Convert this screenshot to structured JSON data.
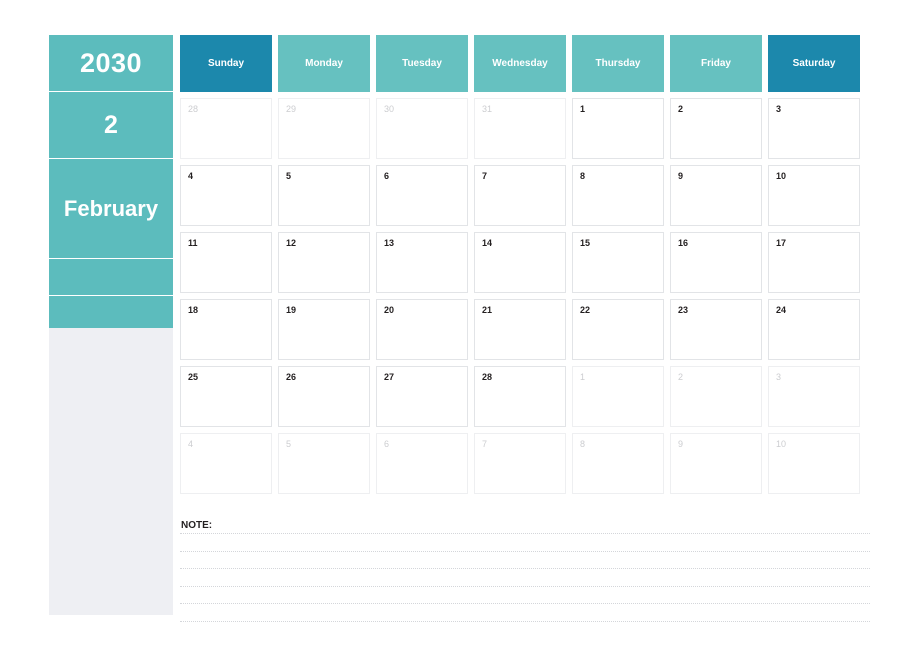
{
  "calendar": {
    "sidebar": {
      "year": "2030",
      "month_number": "2",
      "month_name": "February",
      "blank_block_1": "",
      "blank_block_2": ""
    },
    "weekday_headers": [
      {
        "label": "Sunday",
        "weekend": true
      },
      {
        "label": "Monday",
        "weekend": false
      },
      {
        "label": "Tuesday",
        "weekend": false
      },
      {
        "label": "Wednesday",
        "weekend": false
      },
      {
        "label": "Thursday",
        "weekend": false
      },
      {
        "label": "Friday",
        "weekend": false
      },
      {
        "label": "Saturday",
        "weekend": true
      }
    ],
    "weeks": [
      [
        {
          "day": "28",
          "in_month": false
        },
        {
          "day": "29",
          "in_month": false
        },
        {
          "day": "30",
          "in_month": false
        },
        {
          "day": "31",
          "in_month": false
        },
        {
          "day": "1",
          "in_month": true
        },
        {
          "day": "2",
          "in_month": true
        },
        {
          "day": "3",
          "in_month": true
        }
      ],
      [
        {
          "day": "4",
          "in_month": true
        },
        {
          "day": "5",
          "in_month": true
        },
        {
          "day": "6",
          "in_month": true
        },
        {
          "day": "7",
          "in_month": true
        },
        {
          "day": "8",
          "in_month": true
        },
        {
          "day": "9",
          "in_month": true
        },
        {
          "day": "10",
          "in_month": true
        }
      ],
      [
        {
          "day": "11",
          "in_month": true
        },
        {
          "day": "12",
          "in_month": true
        },
        {
          "day": "13",
          "in_month": true
        },
        {
          "day": "14",
          "in_month": true
        },
        {
          "day": "15",
          "in_month": true
        },
        {
          "day": "16",
          "in_month": true
        },
        {
          "day": "17",
          "in_month": true
        }
      ],
      [
        {
          "day": "18",
          "in_month": true
        },
        {
          "day": "19",
          "in_month": true
        },
        {
          "day": "20",
          "in_month": true
        },
        {
          "day": "21",
          "in_month": true
        },
        {
          "day": "22",
          "in_month": true
        },
        {
          "day": "23",
          "in_month": true
        },
        {
          "day": "24",
          "in_month": true
        }
      ],
      [
        {
          "day": "25",
          "in_month": true
        },
        {
          "day": "26",
          "in_month": true
        },
        {
          "day": "27",
          "in_month": true
        },
        {
          "day": "28",
          "in_month": true
        },
        {
          "day": "1",
          "in_month": false
        },
        {
          "day": "2",
          "in_month": false
        },
        {
          "day": "3",
          "in_month": false
        }
      ],
      [
        {
          "day": "4",
          "in_month": false
        },
        {
          "day": "5",
          "in_month": false
        },
        {
          "day": "6",
          "in_month": false
        },
        {
          "day": "7",
          "in_month": false
        },
        {
          "day": "8",
          "in_month": false
        },
        {
          "day": "9",
          "in_month": false
        },
        {
          "day": "10",
          "in_month": false
        }
      ]
    ],
    "note": {
      "label": "NOTE:",
      "line_count": 6
    },
    "colors": {
      "teal_light": "#5cbcbd",
      "teal_dark": "#1c88ac",
      "header_teal": "#66c1c0",
      "sidebar_panel": "#eeeff3",
      "cell_border": "#e2e4e7",
      "out_of_month_text": "#cccdd0",
      "in_month_text": "#231f20",
      "page_background": "#ffffff"
    }
  }
}
